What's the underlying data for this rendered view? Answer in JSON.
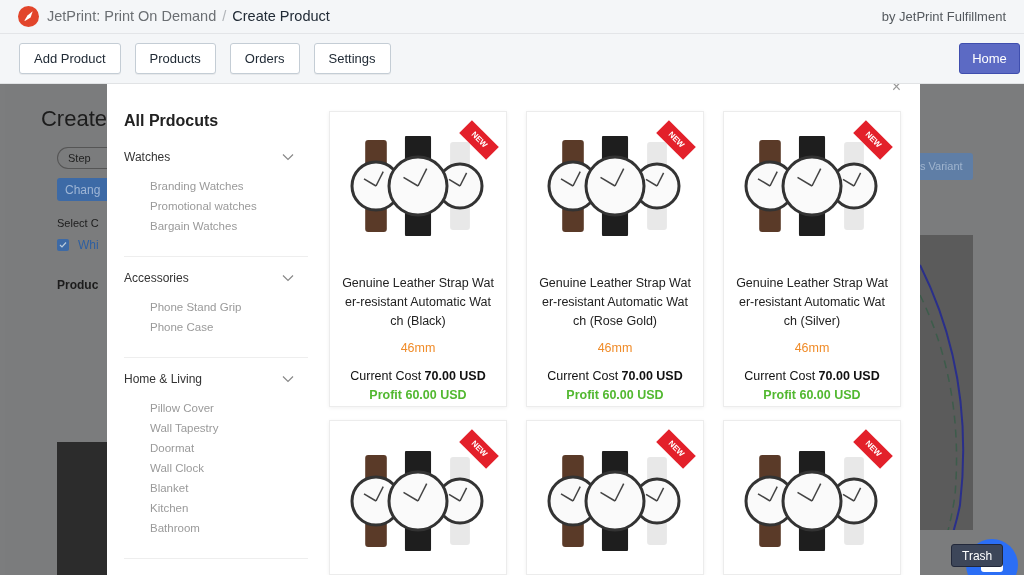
{
  "header": {
    "app_name": "JetPrint: Print On Demand",
    "separator": "/",
    "page": "Create Product",
    "vendor": "by JetPrint Fulfillment"
  },
  "nav": {
    "buttons": [
      "Add Product",
      "Products",
      "Orders",
      "Settings"
    ],
    "home": "Home"
  },
  "background": {
    "heading": "Create",
    "step": "Step",
    "change": "Chang",
    "select_label": "Select C",
    "option": {
      "label": "Whi",
      "checked": true
    },
    "section": "Produc",
    "variant_button": "s Variant"
  },
  "modal": {
    "close": "×",
    "title": "All Prdocuts",
    "categories": [
      {
        "name": "Watches",
        "expanded": true,
        "items": [
          "Branding Watches",
          "Promotional watches",
          "Bargain Watches"
        ]
      },
      {
        "name": "Accessories",
        "expanded": true,
        "items": [
          "Phone Stand Grip",
          "Phone Case"
        ]
      },
      {
        "name": "Home & Living",
        "expanded": true,
        "items": [
          "Pillow Cover",
          "Wall Tapestry",
          "Doormat",
          "Wall Clock",
          "Blanket",
          "Kitchen",
          "Bathroom"
        ]
      }
    ],
    "products": [
      {
        "ribbon": "NEW",
        "name": "Genuine Leather Strap Water-resistant Automatic Watch (Black)",
        "size": "46mm",
        "cost": "Current Cost **70.00 USD**",
        "profit": "Profit 60.00 USD"
      },
      {
        "ribbon": "NEW",
        "name": "Genuine Leather Strap Water-resistant Automatic Watch (Rose Gold)",
        "size": "46mm",
        "cost": "Current Cost **70.00 USD**",
        "profit": "Profit 60.00 USD"
      },
      {
        "ribbon": "NEW",
        "name": "Genuine Leather Strap Water-resistant Automatic Watch (Silver)",
        "size": "46mm",
        "cost": "Current Cost **70.00 USD**",
        "profit": "Profit 60.00 USD"
      },
      {
        "ribbon": "NEW"
      },
      {
        "ribbon": "NEW"
      },
      {
        "ribbon": "NEW"
      }
    ]
  },
  "tooltip": "Trash"
}
